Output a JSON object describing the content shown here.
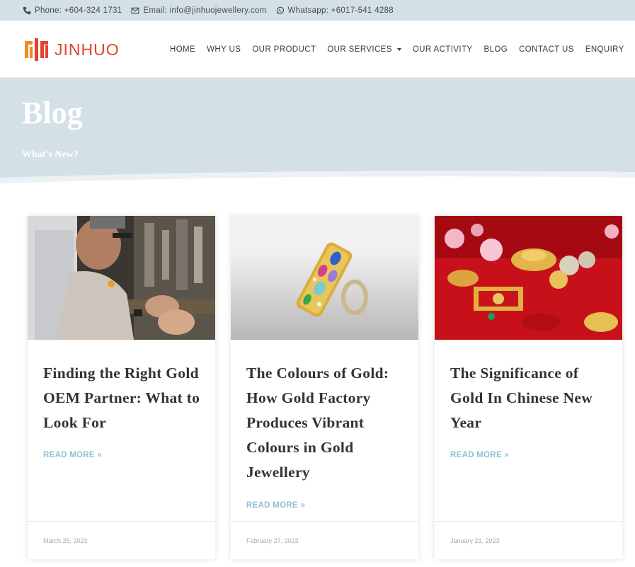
{
  "topbar": {
    "phone": "Phone: +604-324 1731",
    "email": "Email: info@jinhuojewellery.com",
    "whatsapp": "Whatsapp: +6017-541 4288"
  },
  "header": {
    "logo_text": "JINHUO",
    "nav": [
      "HOME",
      "WHY US",
      "OUR PRODUCT",
      "OUR SERVICES",
      "OUR ACTIVITY",
      "BLOG",
      "CONTACT US",
      "ENQUIRY"
    ]
  },
  "banner": {
    "title": "Blog",
    "subtitle": "What's New?"
  },
  "posts": [
    {
      "title": "Finding the Right Gold OEM Partner: What to Look For",
      "more": "READ MORE »",
      "date": "March 25, 2023"
    },
    {
      "title": "The Colours of Gold: How Gold Factory Produces Vibrant Colours in Gold Jewellery",
      "more": "READ MORE »",
      "date": "February 27, 2023"
    },
    {
      "title": "The Significance of Gold In Chinese New Year",
      "more": "READ MORE »",
      "date": "January 21, 2023"
    }
  ],
  "colors": {
    "accent": "#e3442d",
    "banner_bg": "#d3e0e6",
    "read_more": "#8fbfd3"
  }
}
